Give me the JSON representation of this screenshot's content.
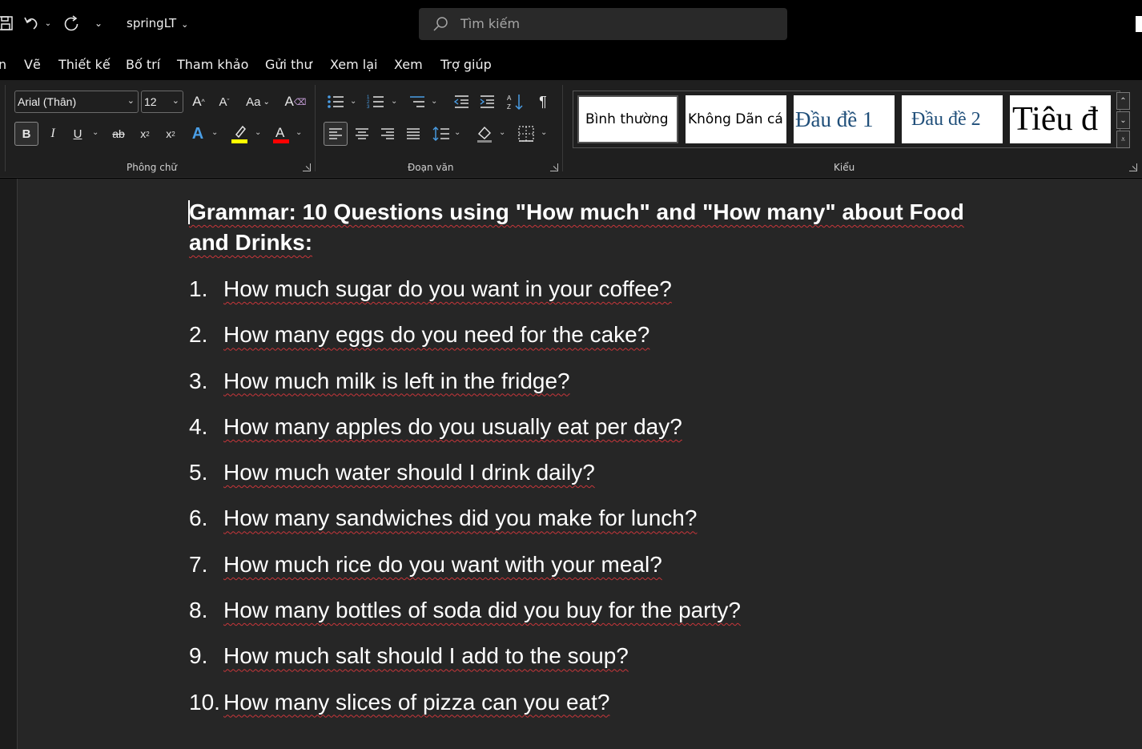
{
  "titlebar": {
    "doc_name": "springLT",
    "search_placeholder": "Tìm kiếm"
  },
  "menu": {
    "items": [
      "n",
      "Vẽ",
      "Thiết kế",
      "Bố trí",
      "Tham khảo",
      "Gửi thư",
      "Xem lại",
      "Xem",
      "Trợ giúp"
    ]
  },
  "ribbon": {
    "font_name": "Arial (Thân)",
    "font_size": "12",
    "groups": {
      "font": "Phông chữ",
      "paragraph": "Đoạn văn",
      "styles": "Kiểu"
    },
    "styles": [
      "Bình thường",
      "Không Dãn cá",
      "Đầu đề 1",
      "Đầu đề 2",
      "Tiêu đ"
    ],
    "highlight_color": "#ffff00",
    "font_color": "#ff0000"
  },
  "document": {
    "heading": "Grammar: 10 Questions using \"How much\" and \"How many\" about Food and Drinks:",
    "questions": [
      {
        "num": "1.",
        "text": "How much sugar do you want in your coffee?"
      },
      {
        "num": "2.",
        "text": "How many eggs do you need for the cake?"
      },
      {
        "num": "3.",
        "text": "How much milk is left in the fridge?"
      },
      {
        "num": "4.",
        "text": "How many apples do you usually eat per day?"
      },
      {
        "num": "5.",
        "text": "How much water should I drink daily?"
      },
      {
        "num": "6.",
        "text": "How many sandwiches did you make for lunch?"
      },
      {
        "num": "7.",
        "text": "How much rice do you want with your meal?"
      },
      {
        "num": "8.",
        "text": "How many bottles of soda did you buy for the party?"
      },
      {
        "num": "9.",
        "text": "How much salt should I add to the soup?"
      },
      {
        "num": "10.",
        "text": "How many slices of pizza can you eat?"
      }
    ]
  }
}
